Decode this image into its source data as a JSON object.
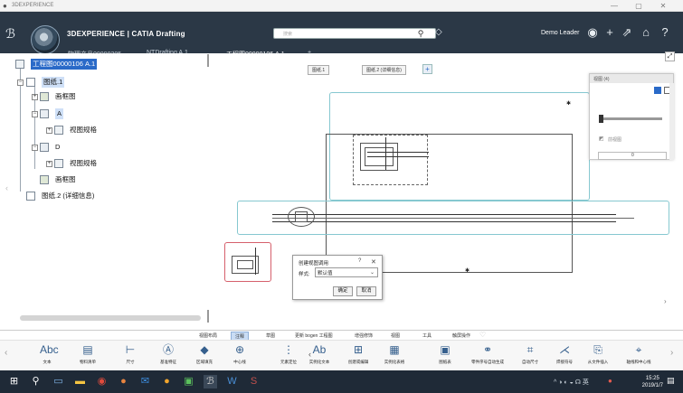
{
  "window": {
    "title": "3DEXPERIENCE",
    "controls": [
      "—",
      "▢",
      "✕"
    ]
  },
  "topbar": {
    "brand_prefix": "3DEXPERIENCE |",
    "brand_app": "CATIA Drafting",
    "search_placeholder": "搜索",
    "user": "Demo Leader",
    "icons": [
      "add-icon",
      "share-icon",
      "home-icon",
      "help-icon"
    ]
  },
  "tabs": [
    {
      "label": "物理产品00000205"
    },
    {
      "label": "NTDrafting A.1"
    },
    {
      "label": "工程图00000106 A.1",
      "active": true
    },
    {
      "label": "+"
    }
  ],
  "tree": {
    "root": "工程图00000106 A.1",
    "items": [
      {
        "label": "图纸.1"
      },
      {
        "label": "画框图"
      },
      {
        "label": "A"
      },
      {
        "label": "视图规格"
      },
      {
        "label": "D"
      },
      {
        "label": "视图规格"
      },
      {
        "label": "画框图"
      },
      {
        "label": "图纸.2 (详细信息)"
      }
    ]
  },
  "canvas": {
    "sheet_tabs": [
      "图纸.1",
      "图纸.2 (详细信息)"
    ],
    "add_sheet": "+"
  },
  "views_panel": {
    "title": "视图 (4)",
    "item_label": "前视图",
    "value": "0"
  },
  "dialog": {
    "title": "创建视图调用",
    "help": "?",
    "close": "✕",
    "style_label": "样式:",
    "style_value": "默认值",
    "ok": "确定",
    "cancel": "取消"
  },
  "ribbon_tabs": [
    {
      "label": "视图布局"
    },
    {
      "label": "注释",
      "active": true
    },
    {
      "label": "草图"
    },
    {
      "label": "更新 bogen 工程图"
    },
    {
      "label": "增强修饰"
    },
    {
      "label": "视图"
    },
    {
      "label": "工具"
    },
    {
      "label": "触屏操作"
    }
  ],
  "ribbon": [
    {
      "icon": "text-icon",
      "label": "文本"
    },
    {
      "icon": "bom-icon",
      "label": "物料清单"
    },
    {
      "icon": "dimension-icon",
      "label": "尺寸"
    },
    {
      "icon": "datum-icon",
      "label": "基准特征"
    },
    {
      "icon": "hatch-icon",
      "label": "区域填充"
    },
    {
      "icon": "centerline-icon",
      "label": "中心线"
    },
    {
      "icon": "element-icon",
      "label": "元素定位"
    },
    {
      "icon": "text-instance-icon",
      "label": "实例化文本"
    },
    {
      "icon": "table-icon",
      "label": "创建或编辑"
    },
    {
      "icon": "table-instance-icon",
      "label": "实例化表格"
    },
    {
      "icon": "gallery-icon",
      "label": "图纸表"
    },
    {
      "icon": "balloon-icon",
      "label": "零件序号自动生成"
    },
    {
      "icon": "auto-dim-icon",
      "label": "自动尺寸"
    },
    {
      "icon": "weld-icon",
      "label": "焊接符号"
    },
    {
      "icon": "import-icon",
      "label": "从文件插入"
    },
    {
      "icon": "axis-icon",
      "label": "轴线和中心线"
    }
  ],
  "taskbar": {
    "time": "15:25",
    "date": "2019/1/7"
  }
}
